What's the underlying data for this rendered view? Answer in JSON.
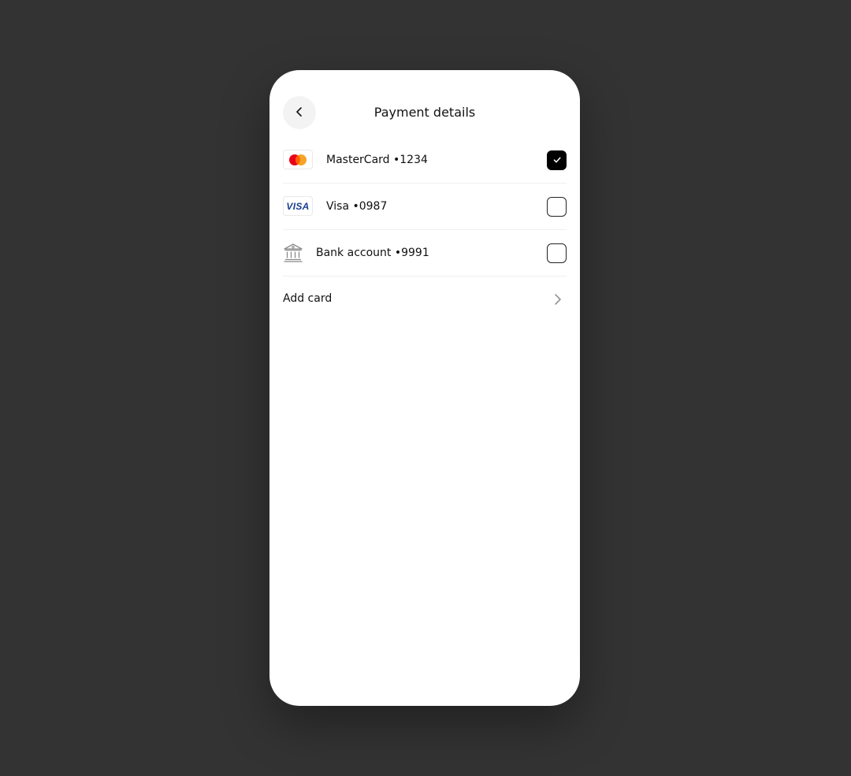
{
  "header": {
    "title": "Payment details"
  },
  "methods": [
    {
      "label": "MasterCard •1234",
      "logo": "mastercard-logo",
      "checked": true
    },
    {
      "label": "Visa •0987",
      "logo": "visa-logo",
      "logo_text": "VISA",
      "checked": false
    },
    {
      "label": "Bank account •9991",
      "logo": "bank-icon",
      "checked": false
    }
  ],
  "add_card": {
    "label": "Add card"
  },
  "colors": {
    "background": "#333333",
    "surface": "#ffffff",
    "accent": "#000000",
    "mastercard_red": "#eb001b",
    "mastercard_orange": "#f79e1b",
    "visa_blue": "#1a3d8f"
  }
}
